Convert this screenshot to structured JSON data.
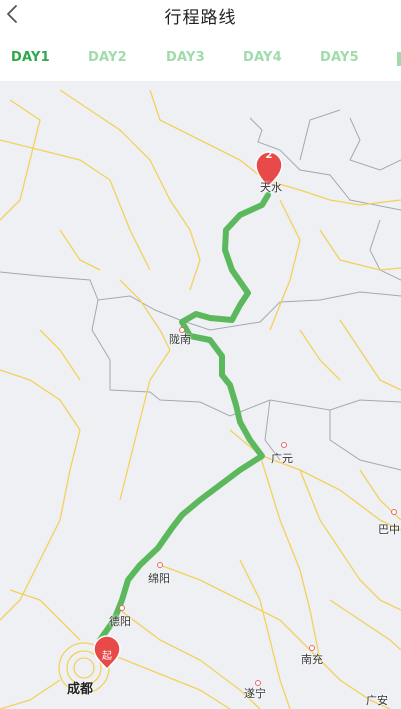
{
  "header": {
    "title": "行程路线",
    "back_icon": "chevron-left-icon"
  },
  "tabs": [
    {
      "label": "DAY1",
      "active": true
    },
    {
      "label": "DAY2",
      "active": false
    },
    {
      "label": "DAY3",
      "active": false
    },
    {
      "label": "DAY4",
      "active": false
    },
    {
      "label": "DAY5",
      "active": false
    }
  ],
  "map": {
    "route_color": "#5cb85c",
    "cities": {
      "tianshui": "天水",
      "longnan": "陇南",
      "guangyuan": "广元",
      "bazhong": "巴中",
      "mianyang": "绵阳",
      "deyang": "德阳",
      "nanchong": "南充",
      "chengdu": "成都",
      "suining": "遂宁",
      "guangan": "广安"
    },
    "markers": {
      "end_label": "2",
      "start_label": "起",
      "color": "#e84a4a"
    }
  }
}
